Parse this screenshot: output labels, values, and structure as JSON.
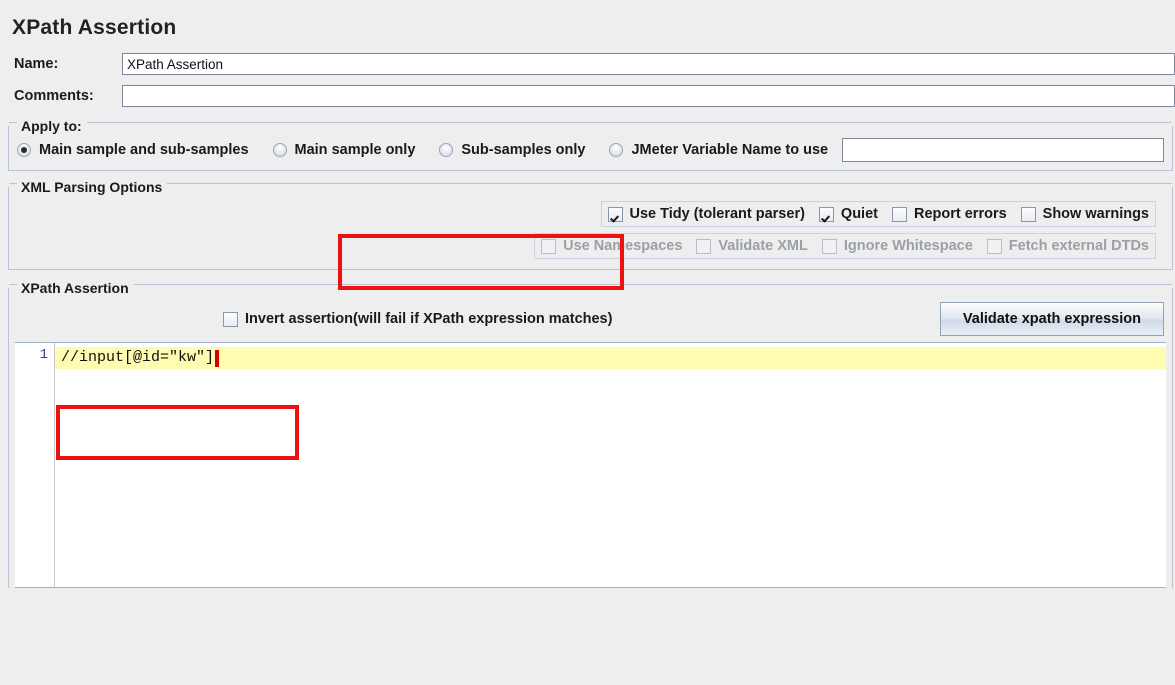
{
  "page": {
    "title": "XPath Assertion"
  },
  "fields": {
    "name_label": "Name:",
    "name_value": "XPath Assertion",
    "comments_label": "Comments:",
    "comments_value": ""
  },
  "apply_to": {
    "group_title": "Apply to:",
    "options": [
      {
        "label": "Main sample and sub-samples",
        "selected": true
      },
      {
        "label": "Main sample only",
        "selected": false
      },
      {
        "label": "Sub-samples only",
        "selected": false
      },
      {
        "label": "JMeter Variable Name to use",
        "selected": false
      }
    ],
    "variable_value": ""
  },
  "xml_parsing": {
    "group_title": "XML Parsing Options",
    "row1": [
      {
        "label": "Use Tidy (tolerant parser)",
        "checked": true,
        "enabled": true
      },
      {
        "label": "Quiet",
        "checked": true,
        "enabled": true
      },
      {
        "label": "Report errors",
        "checked": false,
        "enabled": true
      },
      {
        "label": "Show warnings",
        "checked": false,
        "enabled": true
      }
    ],
    "row2": [
      {
        "label": "Use Namespaces",
        "checked": false,
        "enabled": false
      },
      {
        "label": "Validate XML",
        "checked": false,
        "enabled": false
      },
      {
        "label": "Ignore Whitespace",
        "checked": false,
        "enabled": false
      },
      {
        "label": "Fetch external DTDs",
        "checked": false,
        "enabled": false
      }
    ]
  },
  "assertion": {
    "group_title": "XPath Assertion",
    "invert_label": "Invert assertion(will fail if XPath expression matches)",
    "invert_checked": false,
    "validate_button": "Validate xpath expression",
    "editor": {
      "line_number": "1",
      "expression": "//input[@id=\"kw\"]"
    }
  },
  "colors": {
    "panel_bg": "#eeeeee",
    "border": "#b6c4d6",
    "annotation_red": "#ee1111",
    "highlight_yellow": "#fdfcb0",
    "caret_red": "#d40000",
    "line_number_blue": "#2b4a8b"
  }
}
